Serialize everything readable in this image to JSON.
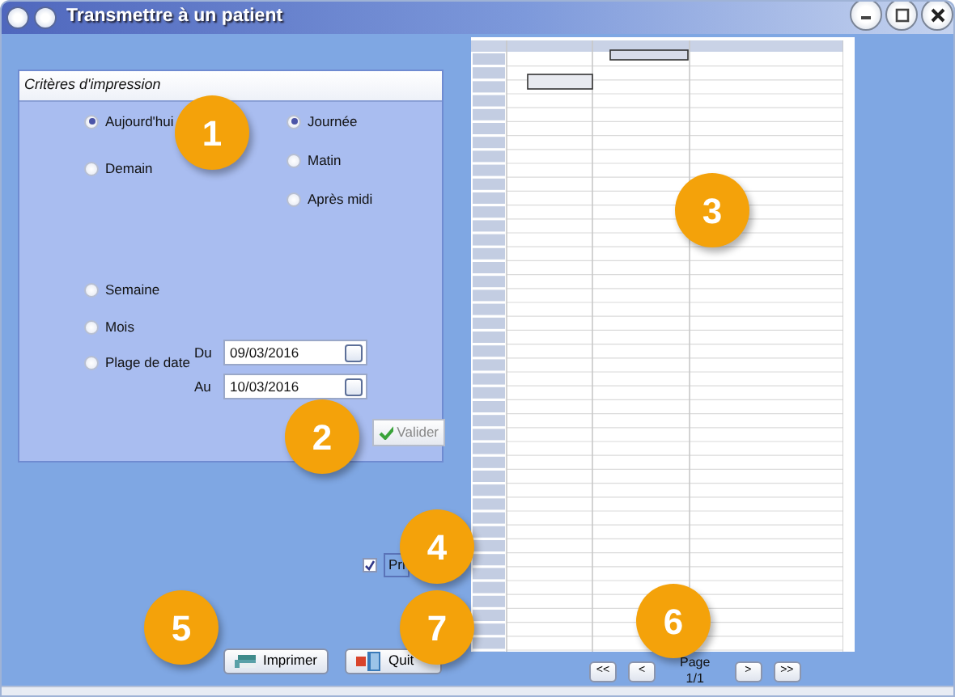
{
  "window": {
    "title": "Transmettre à un patient"
  },
  "criteria": {
    "title": "Critères d'impression",
    "period_options": [
      {
        "label": "Aujourd'hui",
        "selected": true
      },
      {
        "label": "Demain",
        "selected": false
      },
      {
        "label": "Semaine",
        "selected": false
      },
      {
        "label": "Mois",
        "selected": false
      },
      {
        "label": "Plage de date",
        "selected": false
      }
    ],
    "time_options": [
      {
        "label": "Journée",
        "selected": true
      },
      {
        "label": "Matin",
        "selected": false
      },
      {
        "label": "Après midi",
        "selected": false
      }
    ],
    "date_from": {
      "label": "Du",
      "value": "09/03/2016"
    },
    "date_to": {
      "label": "Au",
      "value": "10/03/2016"
    },
    "validate_button": {
      "label": "Valider",
      "disabled": true
    }
  },
  "print_option": {
    "label": "Pri",
    "checked": true
  },
  "buttons": [
    {
      "kind": "print",
      "label": "Imprimer"
    },
    {
      "kind": "quit",
      "label": "Quit"
    }
  ],
  "pager": {
    "first": "<<",
    "prev": "<",
    "label": "Page",
    "page": "1/1",
    "next": ">",
    "last": ">>"
  },
  "callouts": [
    "1",
    "2",
    "3",
    "4",
    "5",
    "7",
    "6"
  ]
}
